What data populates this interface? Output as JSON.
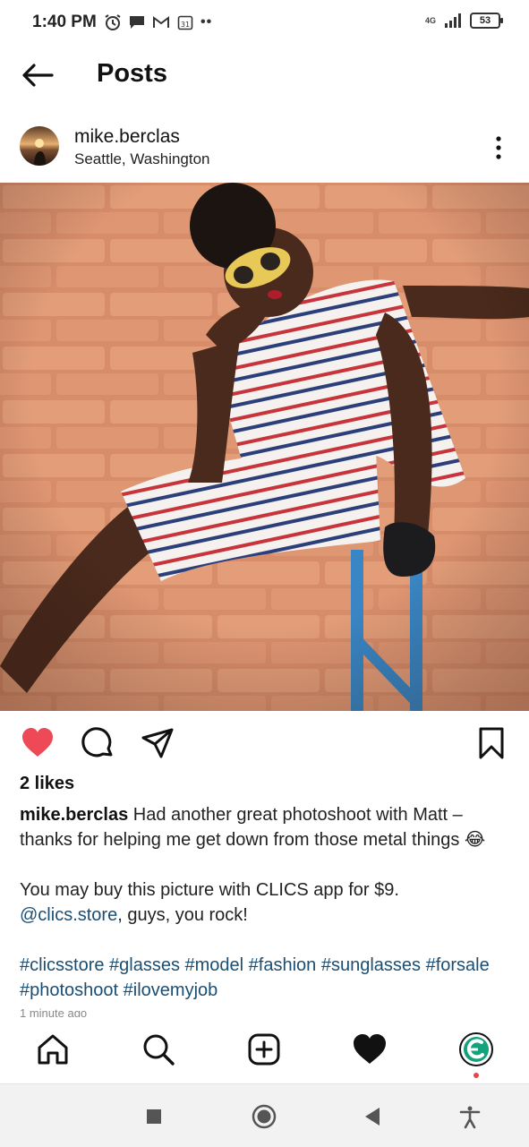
{
  "status": {
    "time": "1:40 PM",
    "network": "4G",
    "battery": "53"
  },
  "header": {
    "title": "Posts"
  },
  "post": {
    "username": "mike.berclas",
    "location": "Seattle, Washington",
    "likes": "2 likes",
    "caption": {
      "user": "mike.berclas",
      "text1": " Had another great photoshoot with Matt – thanks for helping me get down from those metal things 😂",
      "text2": "You may buy this picture with CLICS app for $9.",
      "mention": "@clics.store",
      "text3": ", guys, you rock!",
      "hashtags": "#clicsstore #glasses #model #fashion #sunglasses #forsale #photoshoot #ilovemyjob"
    },
    "timestamp": "1 minute ago"
  },
  "colors": {
    "like": "#ed4956",
    "link": "#1b4e73",
    "badge": "#e8444a"
  },
  "icons": {
    "actions": [
      "heart-filled-icon",
      "comment-icon",
      "share-icon",
      "bookmark-icon"
    ],
    "nav": [
      "home-icon",
      "search-icon",
      "add-post-icon",
      "activity-heart-icon",
      "profile-avatar"
    ],
    "system": [
      "recents-square-icon",
      "home-circle-icon",
      "back-triangle-icon",
      "accessibility-icon"
    ]
  }
}
